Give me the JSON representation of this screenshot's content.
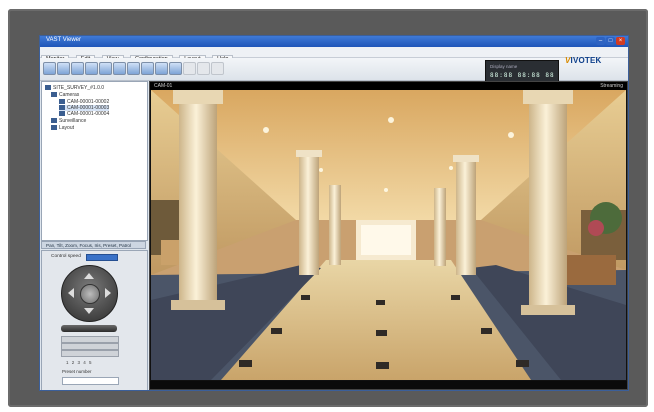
{
  "window": {
    "title": "VAST Viewer"
  },
  "menu": [
    "Monitor",
    "Edit",
    "View",
    "Configuration",
    "Layout",
    "Help"
  ],
  "toolbar": {
    "display_label": "Display name",
    "display_value": "88:88 88:88 88"
  },
  "brand": {
    "prefix": "V",
    "name": "IVOTEK"
  },
  "tree": {
    "items": [
      {
        "label": "SITE_SURVEY_#1.0.0"
      },
      {
        "label": "Cameras"
      },
      {
        "label": "CAM-00001-00002"
      },
      {
        "label": "CAM-00001-00003"
      },
      {
        "label": "CAM-00001-00004"
      },
      {
        "label": "Surveillance"
      },
      {
        "label": "Layout"
      }
    ]
  },
  "ptz": {
    "header": "Pan, Tilt, Zoom, Focus, Iris, Preset, Patrol",
    "speed_label": "Control speed",
    "numbers": "1 2 3 4 5",
    "direction_label": "Preset number"
  },
  "video": {
    "camera": "CAM-01",
    "status": "Streaming"
  },
  "colors": {
    "accent": "#1f55b8",
    "brand": "#0d3f8a"
  }
}
